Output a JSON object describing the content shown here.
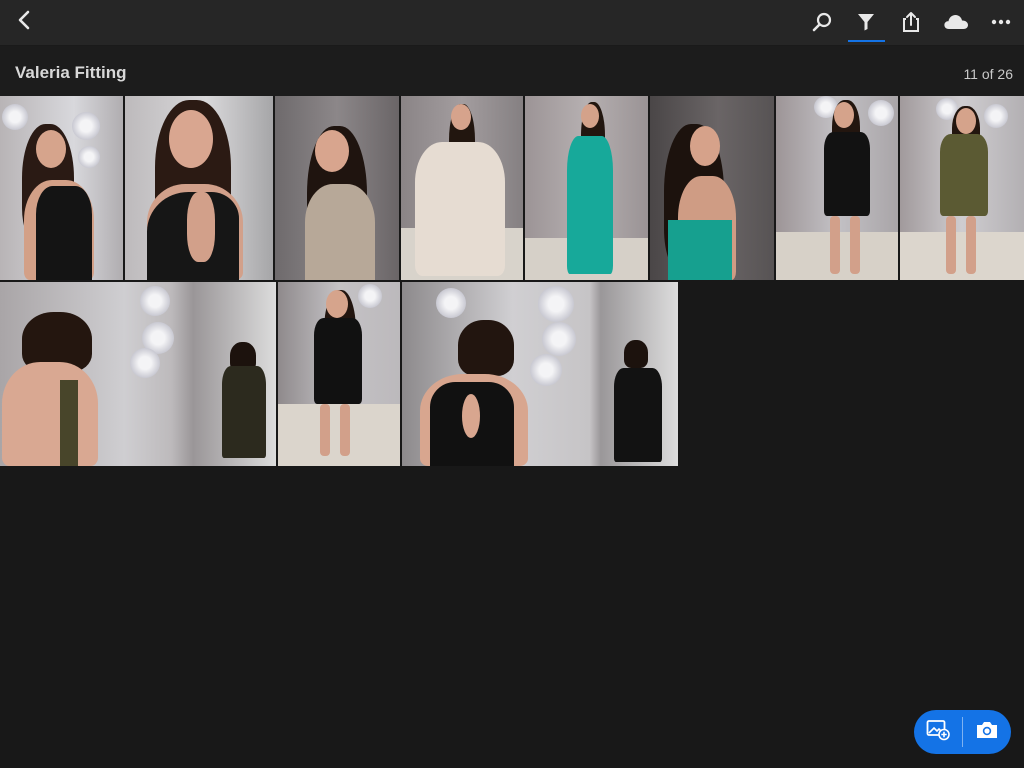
{
  "toolbar": {
    "back_icon": "chevron-left-icon",
    "actions": [
      "search-icon",
      "filter-icon",
      "share-icon",
      "cloud-icon",
      "more-icon"
    ],
    "accent": "#1473e6"
  },
  "album": {
    "title": "Valeria Fitting",
    "count": "11 of 26"
  },
  "photos": [
    {
      "dress": "black lace gown",
      "color": "#141414"
    },
    {
      "dress": "black lace gown back",
      "color": "#141414"
    },
    {
      "dress": "beige beaded gown",
      "color": "#b7a898"
    },
    {
      "dress": "ivory ball gown",
      "color": "#e6dcd2"
    },
    {
      "dress": "teal gown",
      "color": "#17a99a"
    },
    {
      "dress": "teal gown back",
      "color": "#16a08f"
    },
    {
      "dress": "black slip dress",
      "color": "#121212"
    },
    {
      "dress": "olive shift dress",
      "color": "#5b5a33"
    },
    {
      "dress": "olive dress back",
      "color": "#48452a"
    },
    {
      "dress": "black sleeveless dress",
      "color": "#111111"
    },
    {
      "dress": "black dress back",
      "color": "#111111"
    }
  ],
  "fab": {
    "add_photo_icon": "add-photo-icon",
    "camera_icon": "camera-icon",
    "color": "#1473e6"
  }
}
